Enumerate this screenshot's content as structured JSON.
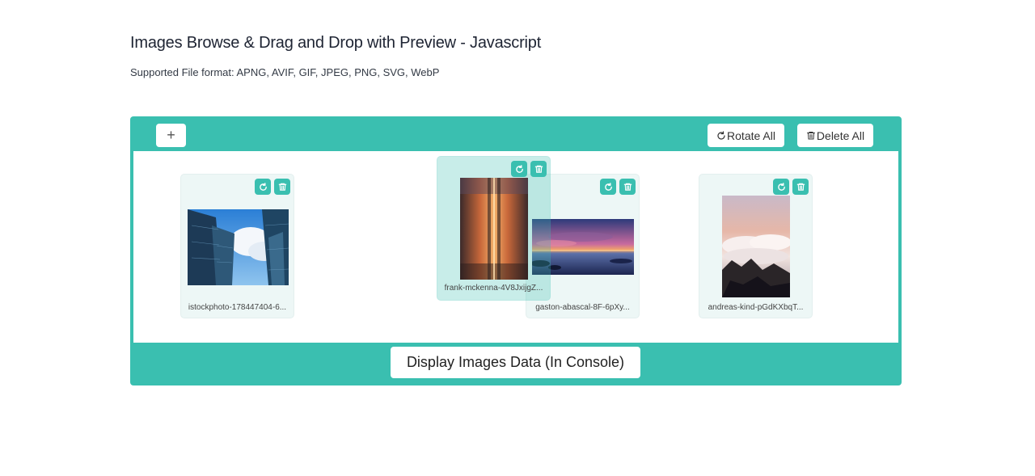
{
  "page": {
    "title": "Images Browse & Drag and Drop with Preview - Javascript",
    "subtitle": "Supported File format: APNG, AVIF, GIF, JPEG, PNG, SVG, WebP"
  },
  "toolbar": {
    "add_label": "+",
    "rotate_all_label": "Rotate All",
    "delete_all_label": "Delete All"
  },
  "images": [
    {
      "name": "istockphoto-178447404-6..."
    },
    {
      "name": "frank-mckenna-4V8JxijgZ..."
    },
    {
      "name": "gaston-abascal-8F-6pXy..."
    },
    {
      "name": "andreas-kind-pGdKXbqT..."
    }
  ],
  "footer": {
    "display_label": "Display Images Data (In Console)"
  },
  "colors": {
    "accent": "#3abfb0",
    "background": "#ffffff"
  }
}
